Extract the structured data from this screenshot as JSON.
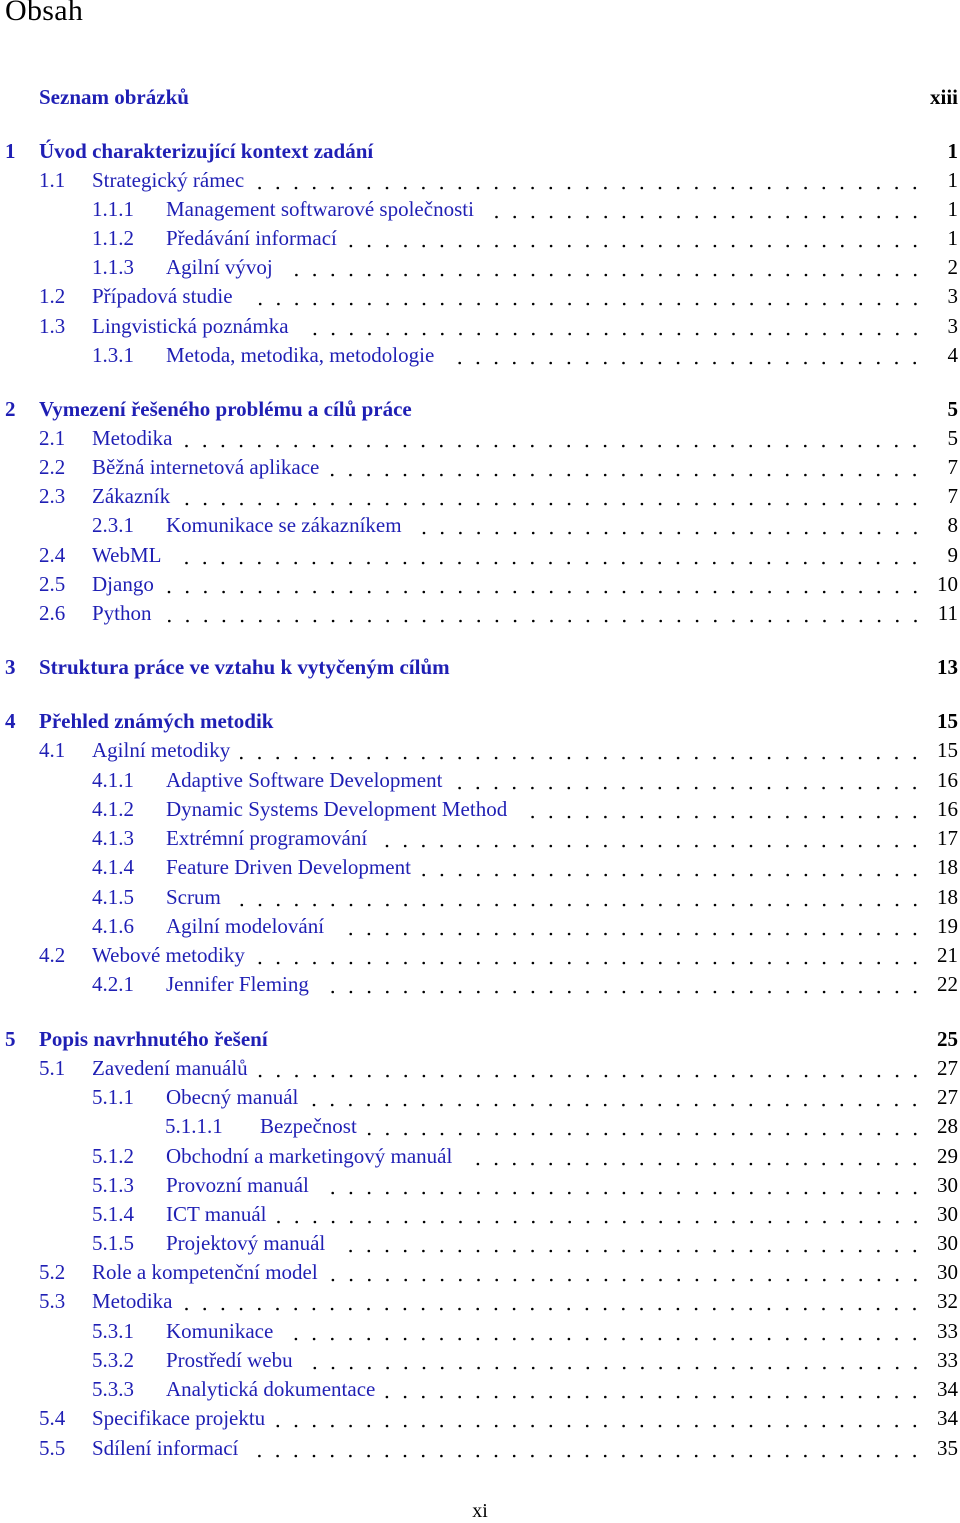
{
  "page_title": "Obsah",
  "footer_page": "xi",
  "colors": {
    "link": "#1f1fb4",
    "text": "#000000"
  },
  "entries": [
    {
      "level": 0,
      "num": "",
      "title": "Seznam obrázků",
      "page": "xiii"
    },
    {
      "level": 0,
      "num": "1",
      "title": "Úvod charakterizující kontext zadání",
      "page": "1"
    },
    {
      "level": 1,
      "num": "1.1",
      "title": "Strategický rámec",
      "page": "1"
    },
    {
      "level": 2,
      "num": "1.1.1",
      "title": "Management softwarové společnosti",
      "page": "1"
    },
    {
      "level": 2,
      "num": "1.1.2",
      "title": "Předávání informací",
      "page": "1"
    },
    {
      "level": 2,
      "num": "1.1.3",
      "title": "Agilní vývoj",
      "page": "2"
    },
    {
      "level": 1,
      "num": "1.2",
      "title": "Případová studie",
      "page": "3"
    },
    {
      "level": 1,
      "num": "1.3",
      "title": "Lingvistická poznámka",
      "page": "3"
    },
    {
      "level": 2,
      "num": "1.3.1",
      "title": "Metoda, metodika, metodologie",
      "page": "4"
    },
    {
      "level": 0,
      "num": "2",
      "title": "Vymezení řešeného problému a cílů práce",
      "page": "5"
    },
    {
      "level": 1,
      "num": "2.1",
      "title": "Metodika",
      "page": "5"
    },
    {
      "level": 1,
      "num": "2.2",
      "title": "Běžná internetová aplikace",
      "page": "7"
    },
    {
      "level": 1,
      "num": "2.3",
      "title": "Zákazník",
      "page": "7"
    },
    {
      "level": 2,
      "num": "2.3.1",
      "title": "Komunikace se zákazníkem",
      "page": "8"
    },
    {
      "level": 1,
      "num": "2.4",
      "title": "WebML",
      "page": "9"
    },
    {
      "level": 1,
      "num": "2.5",
      "title": "Django",
      "page": "10"
    },
    {
      "level": 1,
      "num": "2.6",
      "title": "Python",
      "page": "11"
    },
    {
      "level": 0,
      "num": "3",
      "title": "Struktura práce ve vztahu k vytyčeným cílům",
      "page": "13"
    },
    {
      "level": 0,
      "num": "4",
      "title": "Přehled známých metodik",
      "page": "15"
    },
    {
      "level": 1,
      "num": "4.1",
      "title": "Agilní metodiky",
      "page": "15"
    },
    {
      "level": 2,
      "num": "4.1.1",
      "title": "Adaptive Software Development",
      "page": "16"
    },
    {
      "level": 2,
      "num": "4.1.2",
      "title": "Dynamic Systems Development Method",
      "page": "16"
    },
    {
      "level": 2,
      "num": "4.1.3",
      "title": "Extrémní programování",
      "page": "17"
    },
    {
      "level": 2,
      "num": "4.1.4",
      "title": "Feature Driven Development",
      "page": "18"
    },
    {
      "level": 2,
      "num": "4.1.5",
      "title": "Scrum",
      "page": "18"
    },
    {
      "level": 2,
      "num": "4.1.6",
      "title": "Agilní modelování",
      "page": "19"
    },
    {
      "level": 1,
      "num": "4.2",
      "title": "Webové metodiky",
      "page": "21"
    },
    {
      "level": 2,
      "num": "4.2.1",
      "title": "Jennifer Fleming",
      "page": "22"
    },
    {
      "level": 0,
      "num": "5",
      "title": "Popis navrhnutého řešení",
      "page": "25"
    },
    {
      "level": 1,
      "num": "5.1",
      "title": "Zavedení manuálů",
      "page": "27"
    },
    {
      "level": 2,
      "num": "5.1.1",
      "title": "Obecný manuál",
      "page": "27"
    },
    {
      "level": 3,
      "num": "5.1.1.1",
      "title": "Bezpečnost",
      "page": "28"
    },
    {
      "level": 2,
      "num": "5.1.2",
      "title": "Obchodní a marketingový manuál",
      "page": "29"
    },
    {
      "level": 2,
      "num": "5.1.3",
      "title": "Provozní manuál",
      "page": "30"
    },
    {
      "level": 2,
      "num": "5.1.4",
      "title": "ICT manuál",
      "page": "30"
    },
    {
      "level": 2,
      "num": "5.1.5",
      "title": "Projektový manuál",
      "page": "30"
    },
    {
      "level": 1,
      "num": "5.2",
      "title": "Role a kompetenční model",
      "page": "30"
    },
    {
      "level": 1,
      "num": "5.3",
      "title": "Metodika",
      "page": "32"
    },
    {
      "level": 2,
      "num": "5.3.1",
      "title": "Komunikace",
      "page": "33"
    },
    {
      "level": 2,
      "num": "5.3.2",
      "title": "Prostředí webu",
      "page": "33"
    },
    {
      "level": 2,
      "num": "5.3.3",
      "title": "Analytická dokumentace",
      "page": "34"
    },
    {
      "level": 1,
      "num": "5.4",
      "title": "Specifikace projektu",
      "page": "34"
    },
    {
      "level": 1,
      "num": "5.5",
      "title": "Sdílení informací",
      "page": "35"
    }
  ]
}
